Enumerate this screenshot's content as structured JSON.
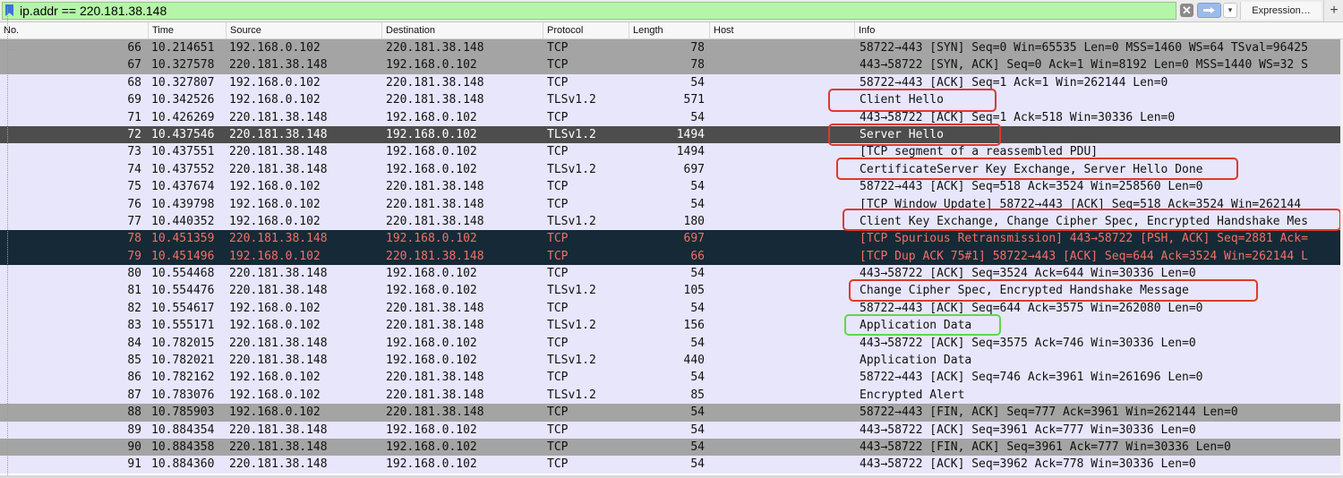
{
  "filter": {
    "value": "ip.addr == 220.181.38.148",
    "expression_label": "Expression…",
    "add_label": "+",
    "clear_label": "✕",
    "dropdown_label": "▾"
  },
  "columns": {
    "no": "No.",
    "time": "Time",
    "source": "Source",
    "destination": "Destination",
    "protocol": "Protocol",
    "length": "Length",
    "host": "Host",
    "info": "Info"
  },
  "packets": [
    {
      "no": "66",
      "time": "10.214651",
      "src": "192.168.0.102",
      "dst": "220.181.38.148",
      "proto": "TCP",
      "len": "78",
      "info": "58722→443 [SYN] Seq=0 Win=65535 Len=0 MSS=1460 WS=64 TSval=96425",
      "style": "gray"
    },
    {
      "no": "67",
      "time": "10.327578",
      "src": "220.181.38.148",
      "dst": "192.168.0.102",
      "proto": "TCP",
      "len": "78",
      "info": "443→58722 [SYN, ACK] Seq=0 Ack=1 Win=8192 Len=0 MSS=1440 WS=32 S",
      "style": "gray"
    },
    {
      "no": "68",
      "time": "10.327807",
      "src": "192.168.0.102",
      "dst": "220.181.38.148",
      "proto": "TCP",
      "len": "54",
      "info": "58722→443 [ACK] Seq=1 Ack=1 Win=262144 Len=0",
      "style": "tcp"
    },
    {
      "no": "69",
      "time": "10.342526",
      "src": "192.168.0.102",
      "dst": "220.181.38.148",
      "proto": "TLSv1.2",
      "len": "571",
      "info": "Client Hello",
      "style": "tls"
    },
    {
      "no": "71",
      "time": "10.426269",
      "src": "220.181.38.148",
      "dst": "192.168.0.102",
      "proto": "TCP",
      "len": "54",
      "info": "443→58722 [ACK] Seq=1 Ack=518 Win=30336 Len=0",
      "style": "tcp"
    },
    {
      "no": "72",
      "time": "10.437546",
      "src": "220.181.38.148",
      "dst": "192.168.0.102",
      "proto": "TLSv1.2",
      "len": "1494",
      "info": "Server Hello",
      "style": "sel"
    },
    {
      "no": "73",
      "time": "10.437551",
      "src": "220.181.38.148",
      "dst": "192.168.0.102",
      "proto": "TCP",
      "len": "1494",
      "info": "[TCP segment of a reassembled PDU]",
      "style": "tcp"
    },
    {
      "no": "74",
      "time": "10.437552",
      "src": "220.181.38.148",
      "dst": "192.168.0.102",
      "proto": "TLSv1.2",
      "len": "697",
      "info": "CertificateServer Key Exchange, Server Hello Done",
      "style": "tls"
    },
    {
      "no": "75",
      "time": "10.437674",
      "src": "192.168.0.102",
      "dst": "220.181.38.148",
      "proto": "TCP",
      "len": "54",
      "info": "58722→443 [ACK] Seq=518 Ack=3524 Win=258560 Len=0",
      "style": "tcp"
    },
    {
      "no": "76",
      "time": "10.439798",
      "src": "192.168.0.102",
      "dst": "220.181.38.148",
      "proto": "TCP",
      "len": "54",
      "info": "[TCP Window Update] 58722→443 [ACK] Seq=518 Ack=3524 Win=262144",
      "style": "tcp"
    },
    {
      "no": "77",
      "time": "10.440352",
      "src": "192.168.0.102",
      "dst": "220.181.38.148",
      "proto": "TLSv1.2",
      "len": "180",
      "info": "Client Key Exchange, Change Cipher Spec, Encrypted Handshake Mes",
      "style": "tls"
    },
    {
      "no": "78",
      "time": "10.451359",
      "src": "220.181.38.148",
      "dst": "192.168.0.102",
      "proto": "TCP",
      "len": "697",
      "info": "[TCP Spurious Retransmission] 443→58722 [PSH, ACK] Seq=2881 Ack=",
      "style": "bad"
    },
    {
      "no": "79",
      "time": "10.451496",
      "src": "192.168.0.102",
      "dst": "220.181.38.148",
      "proto": "TCP",
      "len": "66",
      "info": "[TCP Dup ACK 75#1] 58722→443 [ACK] Seq=644 Ack=3524 Win=262144 L",
      "style": "bad"
    },
    {
      "no": "80",
      "time": "10.554468",
      "src": "220.181.38.148",
      "dst": "192.168.0.102",
      "proto": "TCP",
      "len": "54",
      "info": "443→58722 [ACK] Seq=3524 Ack=644 Win=30336 Len=0",
      "style": "tcp"
    },
    {
      "no": "81",
      "time": "10.554476",
      "src": "220.181.38.148",
      "dst": "192.168.0.102",
      "proto": "TLSv1.2",
      "len": "105",
      "info": "Change Cipher Spec, Encrypted Handshake Message",
      "style": "tls"
    },
    {
      "no": "82",
      "time": "10.554617",
      "src": "192.168.0.102",
      "dst": "220.181.38.148",
      "proto": "TCP",
      "len": "54",
      "info": "58722→443 [ACK] Seq=644 Ack=3575 Win=262080 Len=0",
      "style": "tcp"
    },
    {
      "no": "83",
      "time": "10.555171",
      "src": "192.168.0.102",
      "dst": "220.181.38.148",
      "proto": "TLSv1.2",
      "len": "156",
      "info": "Application Data",
      "style": "tls"
    },
    {
      "no": "84",
      "time": "10.782015",
      "src": "220.181.38.148",
      "dst": "192.168.0.102",
      "proto": "TCP",
      "len": "54",
      "info": "443→58722 [ACK] Seq=3575 Ack=746 Win=30336 Len=0",
      "style": "tcp"
    },
    {
      "no": "85",
      "time": "10.782021",
      "src": "220.181.38.148",
      "dst": "192.168.0.102",
      "proto": "TLSv1.2",
      "len": "440",
      "info": "Application Data",
      "style": "tls"
    },
    {
      "no": "86",
      "time": "10.782162",
      "src": "192.168.0.102",
      "dst": "220.181.38.148",
      "proto": "TCP",
      "len": "54",
      "info": "58722→443 [ACK] Seq=746 Ack=3961 Win=261696 Len=0",
      "style": "tcp"
    },
    {
      "no": "87",
      "time": "10.783076",
      "src": "192.168.0.102",
      "dst": "220.181.38.148",
      "proto": "TLSv1.2",
      "len": "85",
      "info": "Encrypted Alert",
      "style": "tls"
    },
    {
      "no": "88",
      "time": "10.785903",
      "src": "192.168.0.102",
      "dst": "220.181.38.148",
      "proto": "TCP",
      "len": "54",
      "info": "58722→443 [FIN, ACK] Seq=777 Ack=3961 Win=262144 Len=0",
      "style": "gray"
    },
    {
      "no": "89",
      "time": "10.884354",
      "src": "220.181.38.148",
      "dst": "192.168.0.102",
      "proto": "TCP",
      "len": "54",
      "info": "443→58722 [ACK] Seq=3961 Ack=777 Win=30336 Len=0",
      "style": "tcp"
    },
    {
      "no": "90",
      "time": "10.884358",
      "src": "220.181.38.148",
      "dst": "192.168.0.102",
      "proto": "TCP",
      "len": "54",
      "info": "443→58722 [FIN, ACK] Seq=3961 Ack=777 Win=30336 Len=0",
      "style": "gray"
    },
    {
      "no": "91",
      "time": "10.884360",
      "src": "220.181.38.148",
      "dst": "192.168.0.102",
      "proto": "TCP",
      "len": "54",
      "info": "443→58722 [ACK] Seq=3962 Ack=778 Win=30336 Len=0",
      "style": "tcp"
    }
  ],
  "annotations": {
    "highlight_color_red": "#e0382d",
    "highlight_color_green": "#5fd84b"
  },
  "colors": {
    "filter_valid": "#b5f5a8",
    "row_default": "#e8e6fb",
    "row_gray": "#a4a4a4",
    "row_selected": "#4d4d4d",
    "row_bad_bg": "#152a36",
    "row_bad_fg": "#f07068"
  }
}
